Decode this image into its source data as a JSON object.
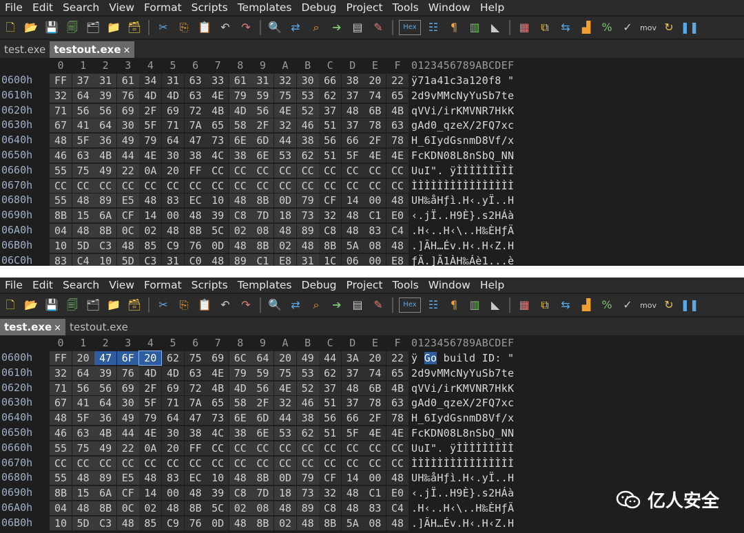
{
  "menu": [
    "File",
    "Edit",
    "Search",
    "View",
    "Format",
    "Scripts",
    "Templates",
    "Debug",
    "Project",
    "Tools",
    "Window",
    "Help"
  ],
  "toolbar_icons": [
    "new-file-icon",
    "open-folder-icon",
    "save-icon",
    "save-as-icon",
    "save-all-icon",
    "folder-icon",
    "folders-icon",
    "cut-icon",
    "copy-icon",
    "paste-icon",
    "undo-icon",
    "redo-icon",
    "find-icon",
    "replace-icon",
    "find-in-files-icon",
    "goto-icon",
    "template-icon",
    "script-icon",
    "hex-icon",
    "toggle-columns-icon",
    "pilcrow-icon",
    "split-icon",
    "highlight-icon",
    "calculator-icon",
    "compare-icon",
    "swap-icon",
    "histogram-icon",
    "percent-icon",
    "checksum-icon",
    "mov-icon",
    "base-convert-icon",
    "pause-icon"
  ],
  "hex_badge": "Hex",
  "mov_label": "mov",
  "pane1": {
    "tabs": [
      {
        "label": "test.exe",
        "active": false
      },
      {
        "label": "testout.exe",
        "active": true,
        "close": "×"
      }
    ],
    "columns": [
      "0",
      "1",
      "2",
      "3",
      "4",
      "5",
      "6",
      "7",
      "8",
      "9",
      "A",
      "B",
      "C",
      "D",
      "E",
      "F"
    ],
    "ascii_header": "0123456789ABCDEF",
    "rows": [
      {
        "offset": "0600h",
        "bytes": [
          "FF",
          "37",
          "31",
          "61",
          "34",
          "31",
          "63",
          "33",
          "61",
          "31",
          "32",
          "30",
          "66",
          "38",
          "20",
          "22"
        ],
        "ascii": "ÿ71a41c3a120f8 \""
      },
      {
        "offset": "0610h",
        "bytes": [
          "32",
          "64",
          "39",
          "76",
          "4D",
          "4D",
          "63",
          "4E",
          "79",
          "59",
          "75",
          "53",
          "62",
          "37",
          "74",
          "65"
        ],
        "ascii": "2d9vMMcNyYuSb7te"
      },
      {
        "offset": "0620h",
        "bytes": [
          "71",
          "56",
          "56",
          "69",
          "2F",
          "69",
          "72",
          "4B",
          "4D",
          "56",
          "4E",
          "52",
          "37",
          "48",
          "6B",
          "4B"
        ],
        "ascii": "qVVi/irKMVNR7HkK"
      },
      {
        "offset": "0630h",
        "bytes": [
          "67",
          "41",
          "64",
          "30",
          "5F",
          "71",
          "7A",
          "65",
          "58",
          "2F",
          "32",
          "46",
          "51",
          "37",
          "78",
          "63"
        ],
        "ascii": "gAd0_qzeX/2FQ7xc"
      },
      {
        "offset": "0640h",
        "bytes": [
          "48",
          "5F",
          "36",
          "49",
          "79",
          "64",
          "47",
          "73",
          "6E",
          "6D",
          "44",
          "38",
          "56",
          "66",
          "2F",
          "78"
        ],
        "ascii": "H_6IydGsnmD8Vf/x"
      },
      {
        "offset": "0650h",
        "bytes": [
          "46",
          "63",
          "4B",
          "44",
          "4E",
          "30",
          "38",
          "4C",
          "38",
          "6E",
          "53",
          "62",
          "51",
          "5F",
          "4E",
          "4E"
        ],
        "ascii": "FcKDN08L8nSbQ_NN"
      },
      {
        "offset": "0660h",
        "bytes": [
          "55",
          "75",
          "49",
          "22",
          "0A",
          "20",
          "FF",
          "CC",
          "CC",
          "CC",
          "CC",
          "CC",
          "CC",
          "CC",
          "CC",
          "CC"
        ],
        "ascii": "UuI\". ÿÌÌÌÌÌÌÌÌÌ"
      },
      {
        "offset": "0670h",
        "bytes": [
          "CC",
          "CC",
          "CC",
          "CC",
          "CC",
          "CC",
          "CC",
          "CC",
          "CC",
          "CC",
          "CC",
          "CC",
          "CC",
          "CC",
          "CC",
          "CC"
        ],
        "ascii": "ÌÌÌÌÌÌÌÌÌÌÌÌÌÌÌÌ"
      },
      {
        "offset": "0680h",
        "bytes": [
          "55",
          "48",
          "89",
          "E5",
          "48",
          "83",
          "EC",
          "10",
          "48",
          "8B",
          "0D",
          "79",
          "CF",
          "14",
          "00",
          "48"
        ],
        "ascii": "UH‰åHƒì.H‹.yÏ..H"
      },
      {
        "offset": "0690h",
        "bytes": [
          "8B",
          "15",
          "6A",
          "CF",
          "14",
          "00",
          "48",
          "39",
          "C8",
          "7D",
          "18",
          "73",
          "32",
          "48",
          "C1",
          "E0"
        ],
        "ascii": "‹.jÏ..H9È}.s2HÁà"
      },
      {
        "offset": "06A0h",
        "bytes": [
          "04",
          "48",
          "8B",
          "0C",
          "02",
          "48",
          "8B",
          "5C",
          "02",
          "08",
          "48",
          "89",
          "C8",
          "48",
          "83",
          "C4"
        ],
        "ascii": ".H‹..H‹\\..H‰ÈHƒÄ"
      },
      {
        "offset": "06B0h",
        "bytes": [
          "10",
          "5D",
          "C3",
          "48",
          "85",
          "C9",
          "76",
          "0D",
          "48",
          "8B",
          "02",
          "48",
          "8B",
          "5A",
          "08",
          "48"
        ],
        "ascii": ".]ÃH…Év.H‹.H‹Z.H"
      },
      {
        "offset": "06C0h",
        "bytes": [
          "83",
          "C4",
          "10",
          "5D",
          "C3",
          "31",
          "C0",
          "48",
          "89",
          "C1",
          "E8",
          "31",
          "1C",
          "06",
          "00",
          "E8"
        ],
        "ascii": "ƒÄ.]Ã1ÀH‰Áè1...è"
      }
    ]
  },
  "pane2": {
    "tabs": [
      {
        "label": "test.exe",
        "active": true,
        "close": "×"
      },
      {
        "label": "testout.exe",
        "active": false
      }
    ],
    "columns": [
      "0",
      "1",
      "2",
      "3",
      "4",
      "5",
      "6",
      "7",
      "8",
      "9",
      "A",
      "B",
      "C",
      "D",
      "E",
      "F"
    ],
    "ascii_header": "0123456789ABCDEF",
    "first_row_ascii": {
      "pre": "ÿ ",
      "hl": "Go",
      "post": " build ID: \""
    },
    "rows": [
      {
        "offset": "0600h",
        "bytes": [
          "FF",
          "20",
          "47",
          "6F",
          "20",
          "62",
          "75",
          "69",
          "6C",
          "64",
          "20",
          "49",
          "44",
          "3A",
          "20",
          "22"
        ],
        "ascii": "ÿ Go build ID: \""
      },
      {
        "offset": "0610h",
        "bytes": [
          "32",
          "64",
          "39",
          "76",
          "4D",
          "4D",
          "63",
          "4E",
          "79",
          "59",
          "75",
          "53",
          "62",
          "37",
          "74",
          "65"
        ],
        "ascii": "2d9vMMcNyYuSb7te"
      },
      {
        "offset": "0620h",
        "bytes": [
          "71",
          "56",
          "56",
          "69",
          "2F",
          "69",
          "72",
          "4B",
          "4D",
          "56",
          "4E",
          "52",
          "37",
          "48",
          "6B",
          "4B"
        ],
        "ascii": "qVVi/irKMVNR7HkK"
      },
      {
        "offset": "0630h",
        "bytes": [
          "67",
          "41",
          "64",
          "30",
          "5F",
          "71",
          "7A",
          "65",
          "58",
          "2F",
          "32",
          "46",
          "51",
          "37",
          "78",
          "63"
        ],
        "ascii": "gAd0_qzeX/2FQ7xc"
      },
      {
        "offset": "0640h",
        "bytes": [
          "48",
          "5F",
          "36",
          "49",
          "79",
          "64",
          "47",
          "73",
          "6E",
          "6D",
          "44",
          "38",
          "56",
          "66",
          "2F",
          "78"
        ],
        "ascii": "H_6IydGsnmD8Vf/x"
      },
      {
        "offset": "0650h",
        "bytes": [
          "46",
          "63",
          "4B",
          "44",
          "4E",
          "30",
          "38",
          "4C",
          "38",
          "6E",
          "53",
          "62",
          "51",
          "5F",
          "4E",
          "4E"
        ],
        "ascii": "FcKDN08L8nSbQ_NN"
      },
      {
        "offset": "0660h",
        "bytes": [
          "55",
          "75",
          "49",
          "22",
          "0A",
          "20",
          "FF",
          "CC",
          "CC",
          "CC",
          "CC",
          "CC",
          "CC",
          "CC",
          "CC",
          "CC"
        ],
        "ascii": "UuI\". ÿÌÌÌÌÌÌÌÌÌ"
      },
      {
        "offset": "0670h",
        "bytes": [
          "CC",
          "CC",
          "CC",
          "CC",
          "CC",
          "CC",
          "CC",
          "CC",
          "CC",
          "CC",
          "CC",
          "CC",
          "CC",
          "CC",
          "CC",
          "CC"
        ],
        "ascii": "ÌÌÌÌÌÌÌÌÌÌÌÌÌÌÌÌ"
      },
      {
        "offset": "0680h",
        "bytes": [
          "55",
          "48",
          "89",
          "E5",
          "48",
          "83",
          "EC",
          "10",
          "48",
          "8B",
          "0D",
          "79",
          "CF",
          "14",
          "00",
          "48"
        ],
        "ascii": "UH‰åHƒì.H‹.yÏ..H"
      },
      {
        "offset": "0690h",
        "bytes": [
          "8B",
          "15",
          "6A",
          "CF",
          "14",
          "00",
          "48",
          "39",
          "C8",
          "7D",
          "18",
          "73",
          "32",
          "48",
          "C1",
          "E0"
        ],
        "ascii": "‹.jÏ..H9È}.s2HÁà"
      },
      {
        "offset": "06A0h",
        "bytes": [
          "04",
          "48",
          "8B",
          "0C",
          "02",
          "48",
          "8B",
          "5C",
          "02",
          "08",
          "48",
          "89",
          "C8",
          "48",
          "83",
          "C4"
        ],
        "ascii": ".H‹..H‹\\..H‰ÈHƒÄ"
      },
      {
        "offset": "06B0h",
        "bytes": [
          "10",
          "5D",
          "C3",
          "48",
          "85",
          "C9",
          "76",
          "0D",
          "48",
          "8B",
          "02",
          "48",
          "8B",
          "5A",
          "08",
          "48"
        ],
        "ascii": ".]ÃH…Év.H‹.H‹Z.H"
      }
    ],
    "selected_bytes": [
      2,
      3
    ],
    "cursor_byte": 4
  },
  "watermark": "亿人安全",
  "colors": {
    "bg": "#1e1e1e",
    "chrome": "#2b2b2b",
    "selection": "#2d5d9e",
    "active_tab": "#6a6a6a"
  }
}
